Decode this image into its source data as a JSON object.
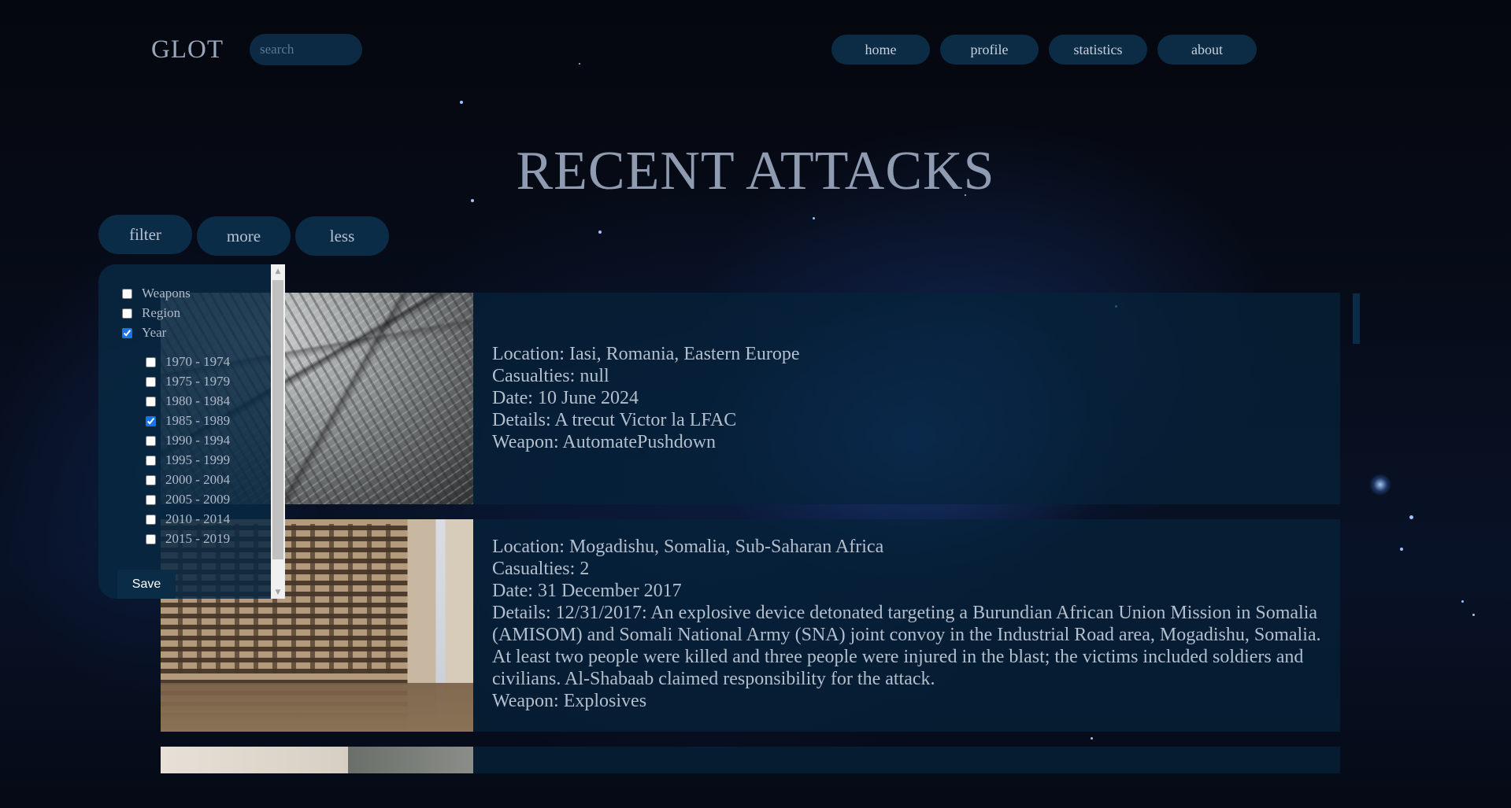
{
  "header": {
    "logo": "GLOT",
    "search_placeholder": "search",
    "nav": [
      "home",
      "profile",
      "statistics",
      "about"
    ]
  },
  "page_title": "RECENT ATTACKS",
  "controls": {
    "filter_label": "filter",
    "more_label": "more",
    "less_label": "less"
  },
  "filter_panel": {
    "categories": [
      {
        "label": "Weapons",
        "checked": false
      },
      {
        "label": "Region",
        "checked": false
      },
      {
        "label": "Year",
        "checked": true
      }
    ],
    "years": [
      {
        "label": "1970 - 1974",
        "checked": false
      },
      {
        "label": "1975 - 1979",
        "checked": false
      },
      {
        "label": "1980 - 1984",
        "checked": false
      },
      {
        "label": "1985 - 1989",
        "checked": true
      },
      {
        "label": "1990 - 1994",
        "checked": false
      },
      {
        "label": "1995 - 1999",
        "checked": false
      },
      {
        "label": "2000 - 2004",
        "checked": false
      },
      {
        "label": "2005 - 2009",
        "checked": false
      },
      {
        "label": "2010 - 2014",
        "checked": false
      },
      {
        "label": "2015 - 2019",
        "checked": false
      }
    ],
    "save_label": "Save"
  },
  "attacks": [
    {
      "location": "Location: Iasi, Romania, Eastern Europe",
      "casualties": "Casualties: null",
      "date": "Date: 10 June 2024",
      "details": "Details: A trecut Victor la LFAC",
      "weapon": "Weapon: AutomatePushdown",
      "image": "rubble-photo"
    },
    {
      "location": "Location: Mogadishu, Somalia, Sub-Saharan Africa",
      "casualties": "Casualties: 2",
      "date": "Date: 31 December 2017",
      "details": "Details: 12/31/2017: An explosive device detonated targeting a Burundian African Union Mission in Somalia (AMISOM) and Somali National Army (SNA) joint convoy in the Industrial Road area, Mogadishu, Somalia. At least two people were killed and three people were injured in the blast; the victims included soldiers and civilians. Al-Shabaab claimed responsibility for the attack.",
      "weapon": "Weapon: Explosives",
      "image": "damaged-building-photo"
    },
    {
      "image": "smoke-photo"
    }
  ],
  "colors": {
    "panel": "#0b2c47",
    "text": "#b4bfcd",
    "title": "#8f9bb0",
    "checkbox_accent": "#1a73e8"
  }
}
